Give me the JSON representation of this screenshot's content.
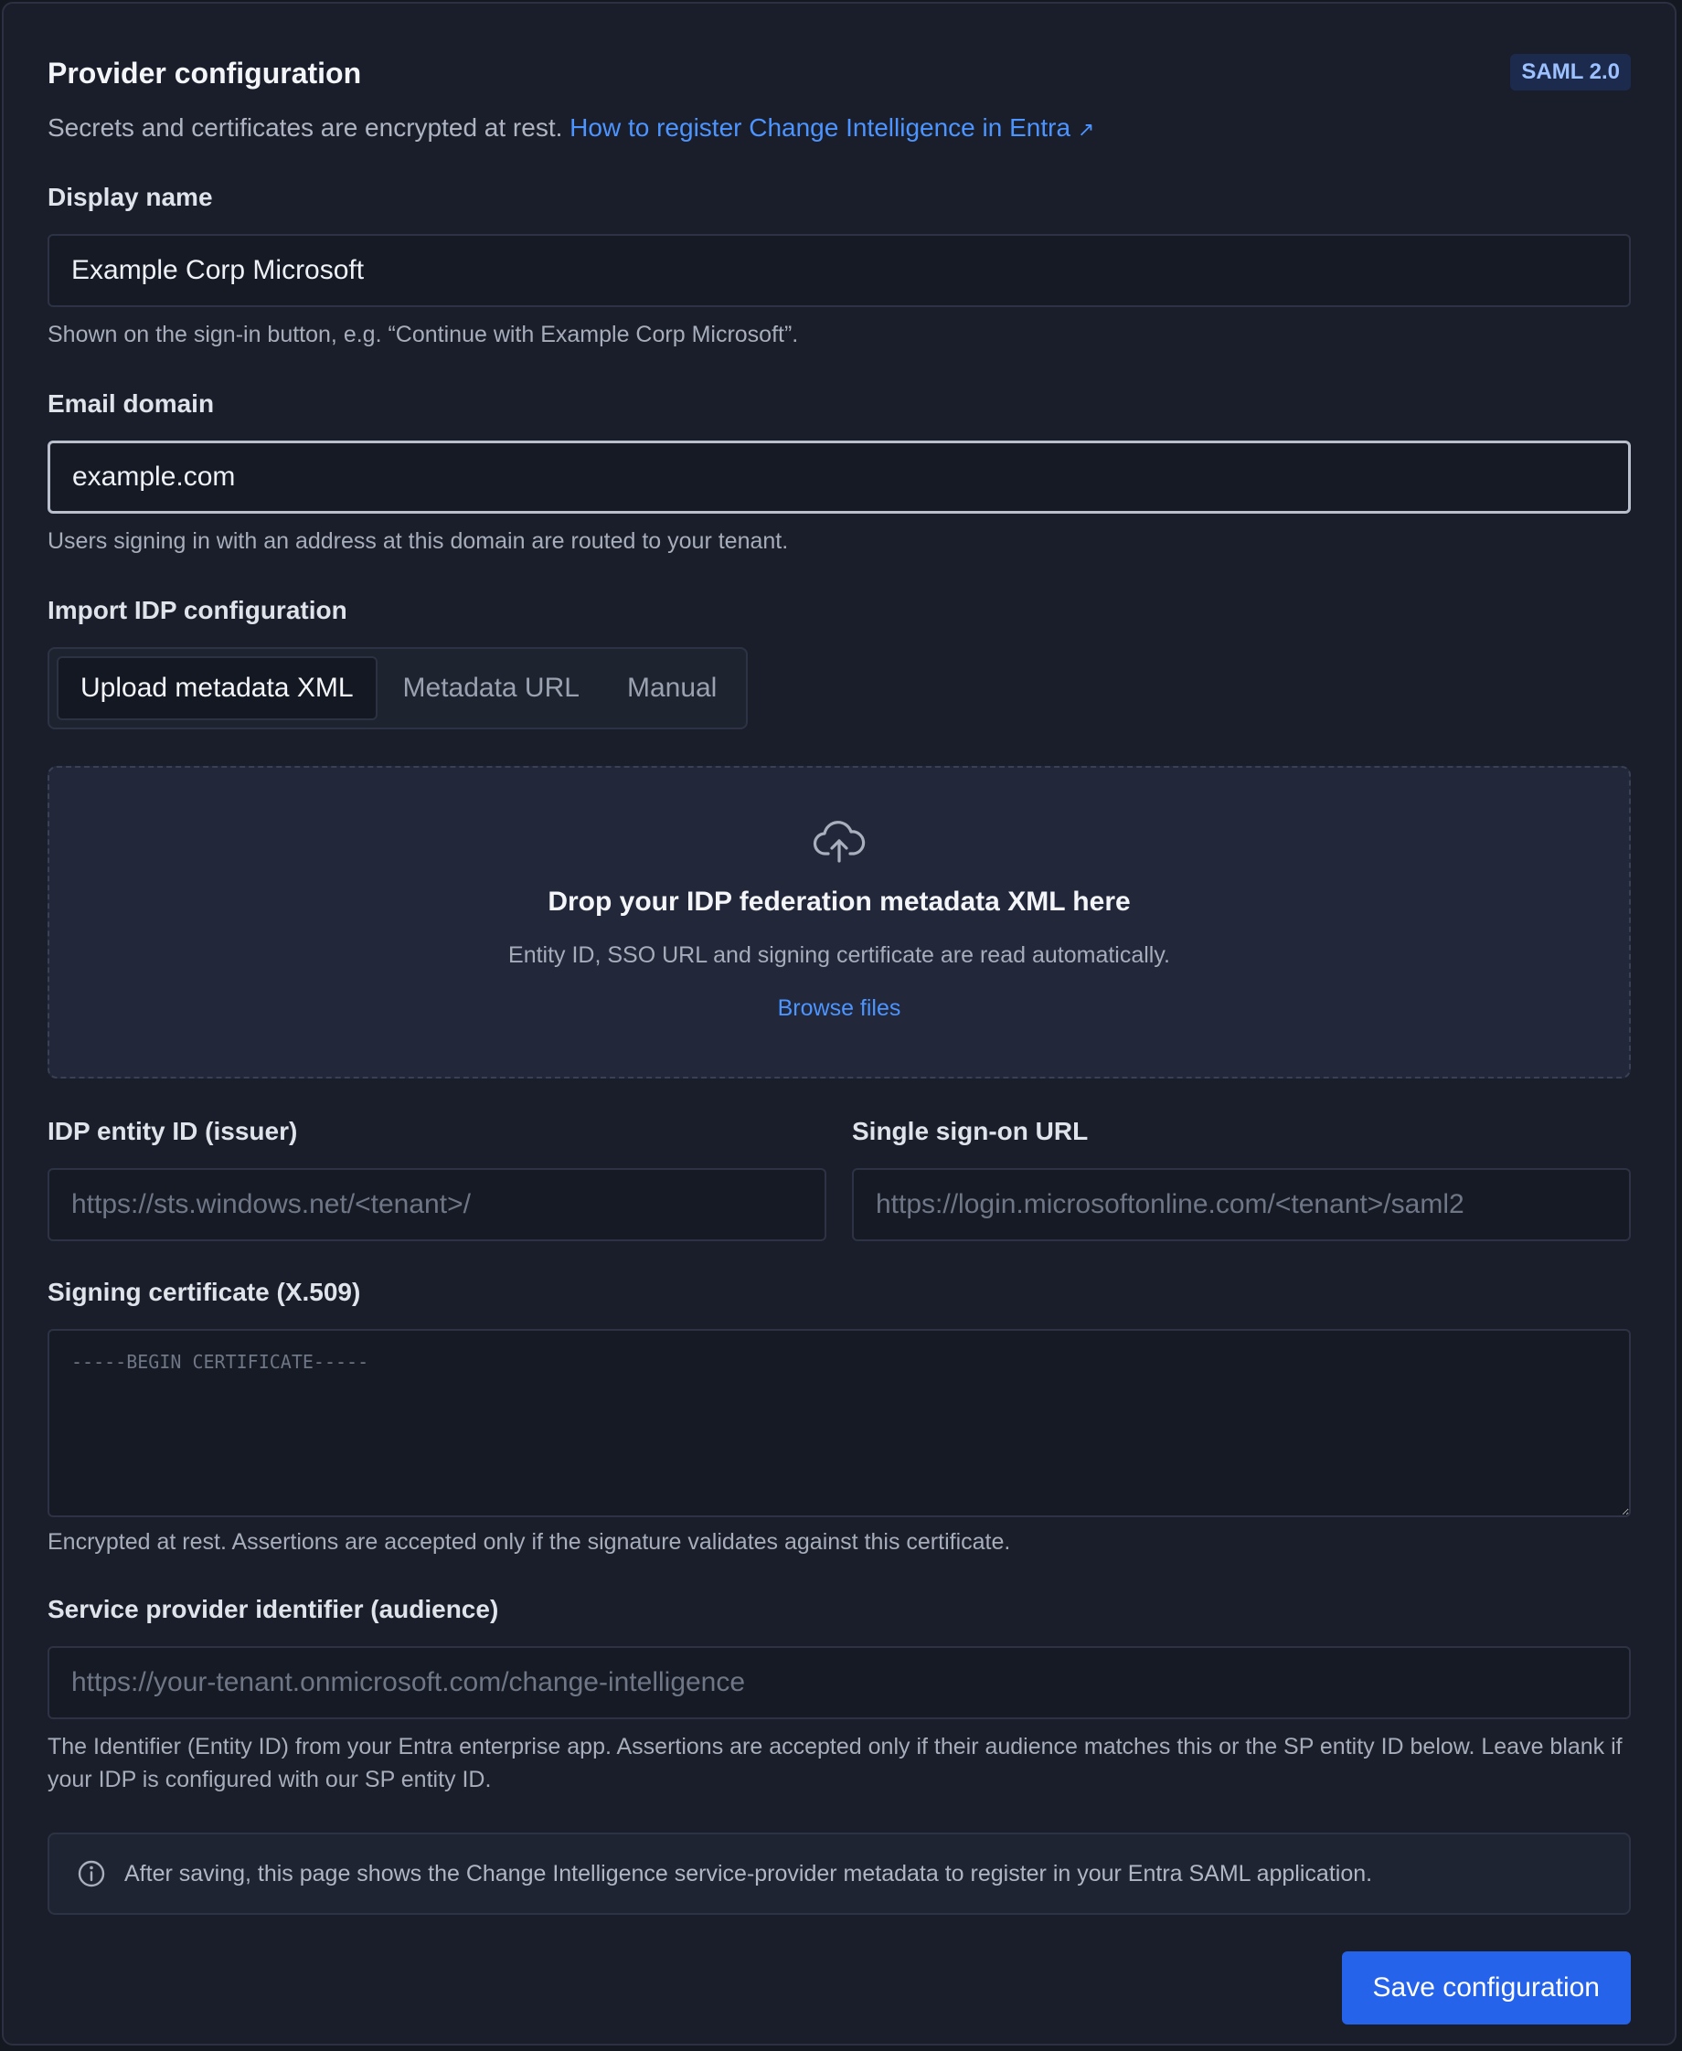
{
  "header": {
    "title": "Provider configuration",
    "badge": "SAML 2.0",
    "subtitle": "Secrets and certificates are encrypted at rest.",
    "link_text": "How to register Change Intelligence in Entra",
    "link_icon": "↗"
  },
  "display_name": {
    "label": "Display name",
    "value": "Example Corp Microsoft",
    "help": "Shown on the sign-in button, e.g. “Continue with Example Corp Microsoft”."
  },
  "email_domain": {
    "label": "Email domain",
    "value": "example.com",
    "help": "Users signing in with an address at this domain are routed to your tenant."
  },
  "import": {
    "label": "Import IDP configuration",
    "tabs": [
      {
        "label": "Upload metadata XML",
        "active": true
      },
      {
        "label": "Metadata URL",
        "active": false
      },
      {
        "label": "Manual",
        "active": false
      }
    ]
  },
  "dropzone": {
    "icon": "cloud-upload-icon",
    "title": "Drop your IDP federation metadata XML here",
    "subtitle": "Entity ID, SSO URL and signing certificate are read automatically.",
    "browse": "Browse files"
  },
  "idp_entity": {
    "label": "IDP entity ID (issuer)",
    "placeholder": "https://sts.windows.net/<tenant>/"
  },
  "sso_url": {
    "label": "Single sign-on URL",
    "placeholder": "https://login.microsoftonline.com/<tenant>/saml2"
  },
  "certificate": {
    "label": "Signing certificate (X.509)",
    "placeholder": "-----BEGIN CERTIFICATE-----",
    "help": "Encrypted at rest. Assertions are accepted only if the signature validates against this certificate."
  },
  "audience": {
    "label": "Service provider identifier (audience)",
    "placeholder": "https://your-tenant.onmicrosoft.com/change-intelligence",
    "help": "The Identifier (Entity ID) from your Entra enterprise app. Assertions are accepted only if their audience matches this or the SP entity ID below. Leave blank if your IDP is configured with our SP entity ID."
  },
  "info": {
    "icon": "info-icon",
    "text": "After saving, this page shows the Change Intelligence service-provider metadata to register in your Entra SAML application."
  },
  "footer": {
    "save_label": "Save configuration"
  },
  "colors": {
    "accent": "#2563eb",
    "link": "#4c94ff",
    "panel_bg": "#1a1e2b"
  }
}
